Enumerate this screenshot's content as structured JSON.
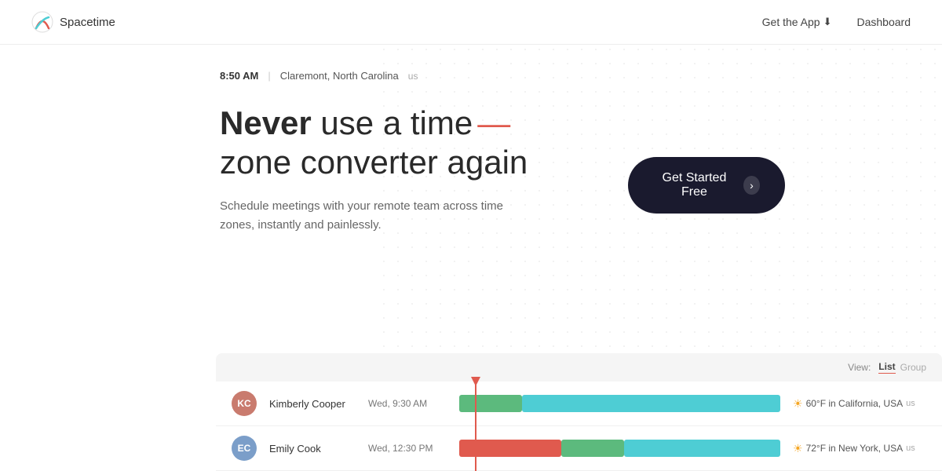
{
  "nav": {
    "brand": "Spacetime",
    "get_app_label": "Get the App",
    "dashboard_label": "Dashboard"
  },
  "location": {
    "time": "8:50 AM",
    "city": "Claremont, North Carolina",
    "country": "us"
  },
  "hero": {
    "title_strong": "Never",
    "title_rest1": " use a time",
    "title_dash": "—",
    "title_rest2": "zone converter again",
    "subtitle": "Schedule meetings with your remote team across time zones, instantly and painlessly."
  },
  "cta": {
    "label": "Get Started Free",
    "arrow": "›"
  },
  "schedule": {
    "view_label": "View:",
    "view_list": "List",
    "view_group": "Group",
    "rows": [
      {
        "name": "Kimberly Cooper",
        "time": "Wed, 9:30 AM",
        "location": "60°F in California, USA",
        "country": "us",
        "avatar_initials": "KC"
      },
      {
        "name": "Emily Cook",
        "time": "Wed, 12:30 PM",
        "location": "72°F in New York, USA",
        "country": "us",
        "avatar_initials": "EC"
      }
    ],
    "colors": {
      "red": "#e05a4e",
      "green": "#5cba7d",
      "cyan": "#4ecdd4"
    }
  }
}
